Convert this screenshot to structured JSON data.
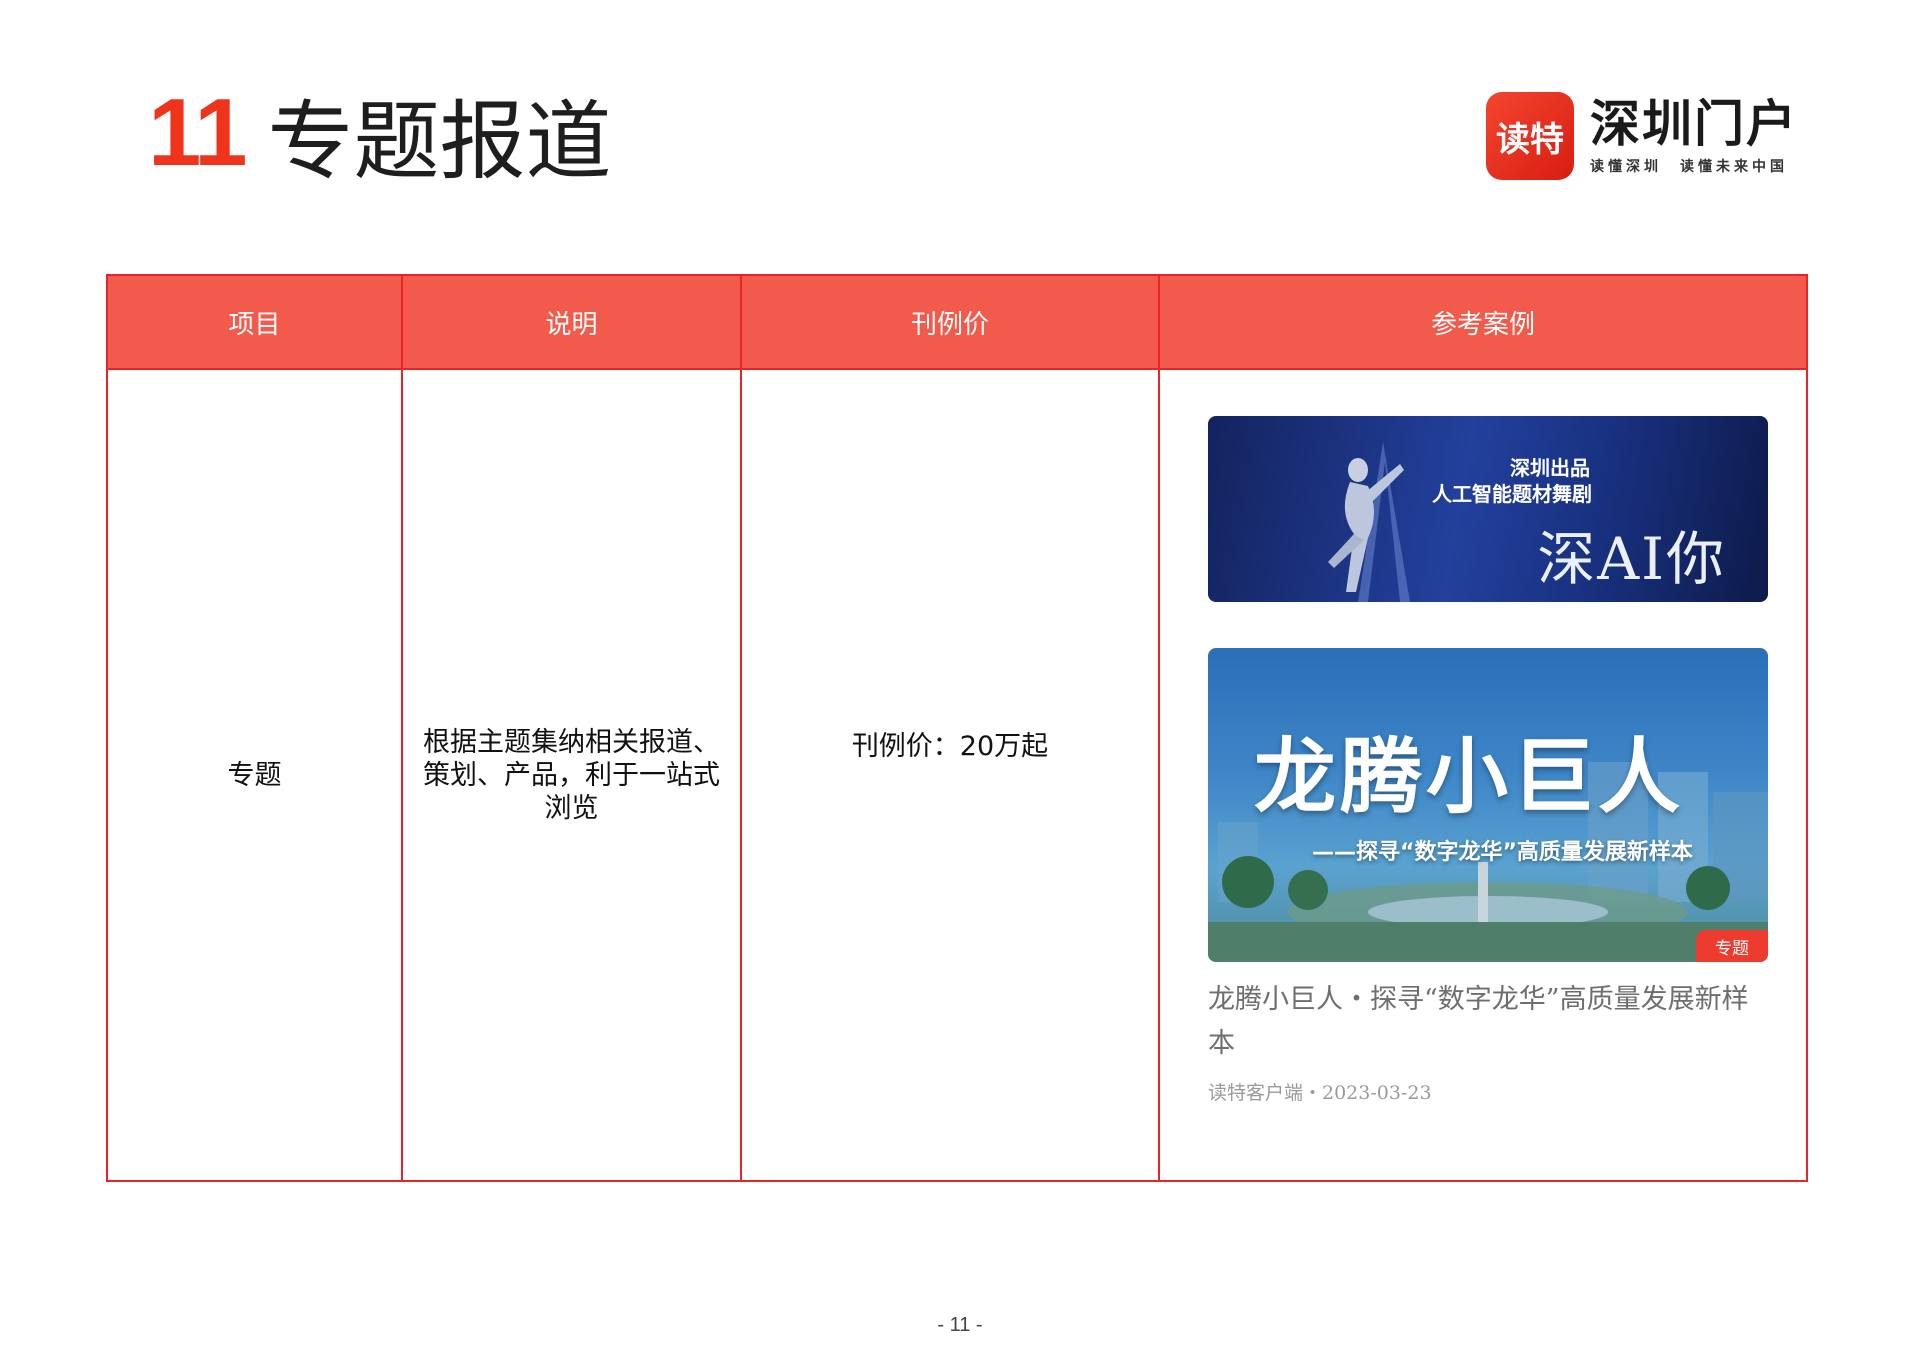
{
  "header": {
    "section_number": "11",
    "section_title": "专题报道"
  },
  "logo": {
    "badge_text": "读特",
    "main_text": "深圳门户",
    "sub_left": "读懂深圳",
    "sub_right": "读懂未来中国"
  },
  "table": {
    "headers": [
      "项目",
      "说明",
      "刊例价",
      "参考案例"
    ],
    "row": {
      "item": "专题",
      "description": "根据主题集纳相关报道、策划、产品，利于一站式浏览",
      "price": "刊例价：20万起"
    }
  },
  "cases": {
    "banner1": {
      "line1": "深圳出品",
      "line2": "人工智能题材舞剧",
      "title": "深AI你"
    },
    "banner2": {
      "title": "龙腾小巨人",
      "subtitle": "——探寻“数字龙华”高质量发展新样本",
      "tag": "专题"
    },
    "article_title": "龙腾小巨人・探寻“数字龙华”高质量发展新样本",
    "article_meta": "读特客户端・2023-03-23"
  },
  "footer": {
    "page_number": "- 11 -"
  }
}
